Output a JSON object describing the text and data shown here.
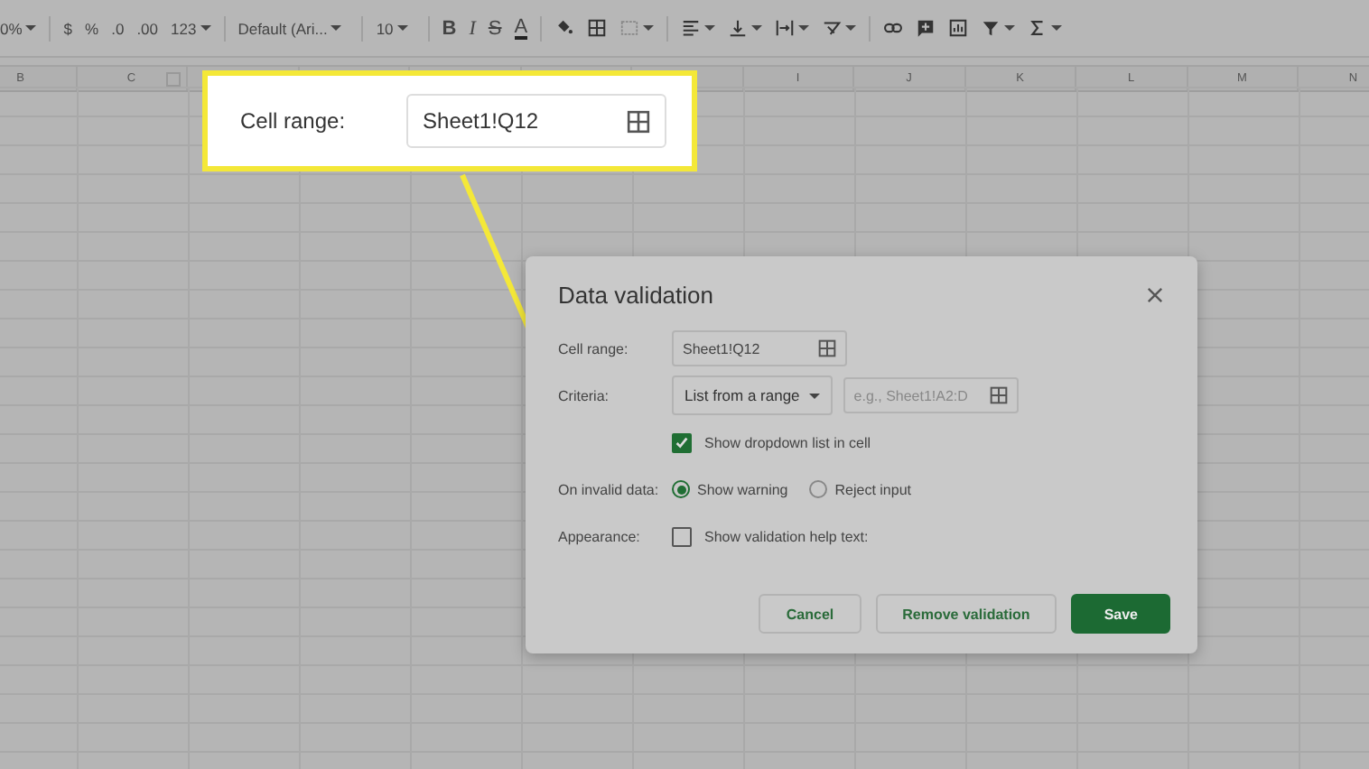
{
  "toolbar": {
    "items": [
      "0%",
      "$",
      "%",
      ".0",
      ".00",
      "123",
      "Default (Ari...",
      "10",
      "B",
      "I",
      "S",
      "A"
    ]
  },
  "column_headers": [
    "B",
    "C",
    "I",
    "J",
    "K",
    "L",
    "M",
    "N"
  ],
  "callout": {
    "label": "Cell range:",
    "value": "Sheet1!Q12"
  },
  "dialog": {
    "title": "Data validation",
    "cell_range": {
      "label": "Cell range:",
      "value": "Sheet1!Q12"
    },
    "criteria": {
      "label": "Criteria:",
      "type": "List from a range",
      "placeholder": "e.g., Sheet1!A2:D"
    },
    "show_dropdown": {
      "label": "Show dropdown list in cell",
      "checked": true
    },
    "on_invalid": {
      "label": "On invalid data:",
      "options": [
        {
          "label": "Show warning",
          "selected": true
        },
        {
          "label": "Reject input",
          "selected": false
        }
      ]
    },
    "appearance": {
      "label": "Appearance:",
      "help": {
        "label": "Show validation help text:",
        "checked": false
      }
    },
    "buttons": [
      {
        "label": "Cancel",
        "kind": "secondary"
      },
      {
        "label": "Remove validation",
        "kind": "secondary"
      },
      {
        "label": "Save",
        "kind": "primary"
      }
    ]
  }
}
